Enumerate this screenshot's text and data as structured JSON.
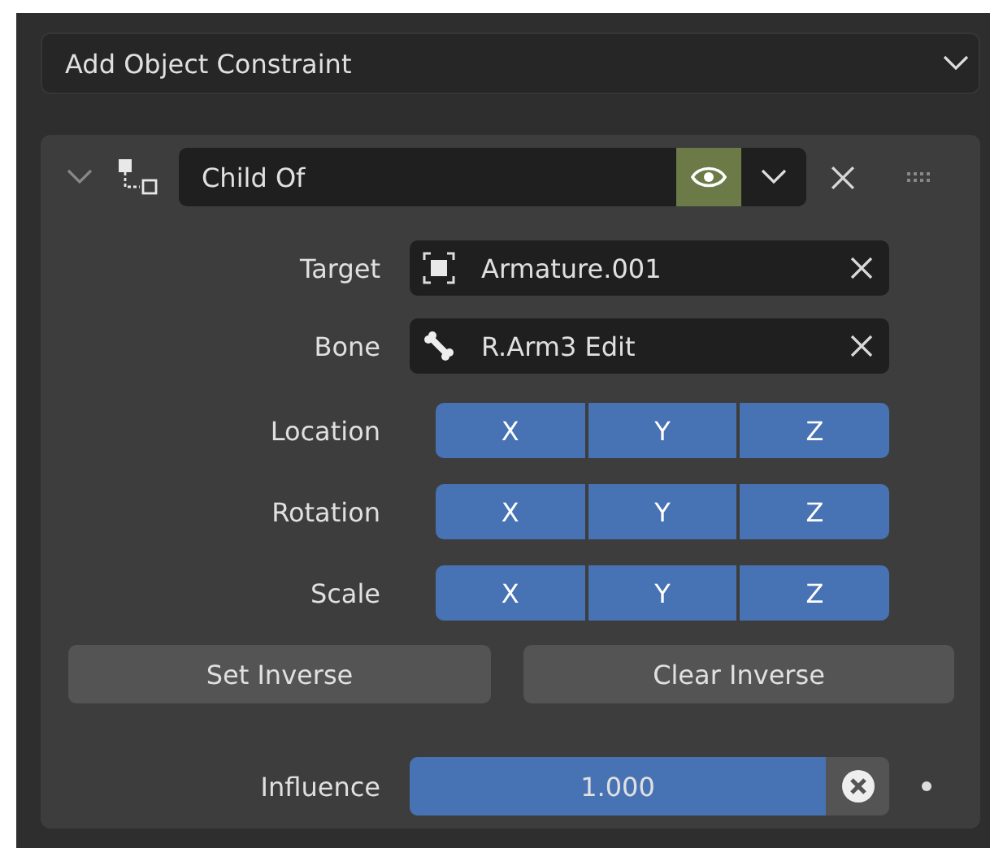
{
  "add_menu": {
    "label": "Add Object Constraint"
  },
  "constraint": {
    "expanded": true,
    "name": "Child Of",
    "enabled": true,
    "fields": [
      {
        "kind": "object",
        "label": "Target",
        "value": "Armature.001"
      },
      {
        "kind": "bone",
        "label": "Bone",
        "value": "R.Arm3 Edit"
      }
    ],
    "axis_rows": [
      {
        "label": "Location",
        "axes": [
          {
            "label": "X",
            "on": true
          },
          {
            "label": "Y",
            "on": true
          },
          {
            "label": "Z",
            "on": true
          }
        ]
      },
      {
        "label": "Rotation",
        "axes": [
          {
            "label": "X",
            "on": true
          },
          {
            "label": "Y",
            "on": true
          },
          {
            "label": "Z",
            "on": true
          }
        ]
      },
      {
        "label": "Scale",
        "axes": [
          {
            "label": "X",
            "on": true
          },
          {
            "label": "Y",
            "on": true
          },
          {
            "label": "Z",
            "on": true
          }
        ]
      }
    ],
    "buttons": [
      "Set Inverse",
      "Clear Inverse"
    ],
    "influence": {
      "label": "Influence",
      "reading": "1.000",
      "level": 1
    }
  }
}
